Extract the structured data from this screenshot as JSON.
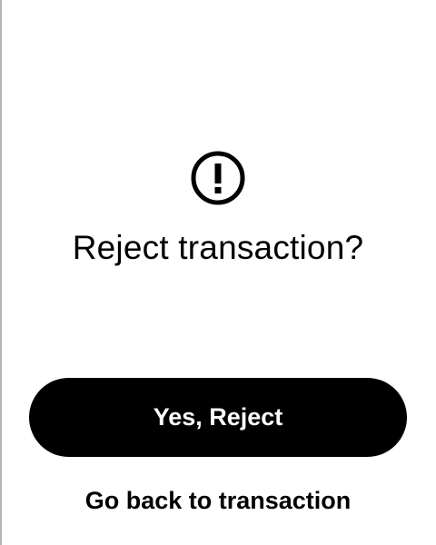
{
  "dialog": {
    "icon": "exclamation-circle-icon",
    "title": "Reject transaction?",
    "confirm_label": "Yes, Reject",
    "back_label": "Go back to transaction"
  },
  "colors": {
    "background": "#ffffff",
    "button_background": "#000000",
    "button_text": "#ffffff",
    "text": "#000000"
  }
}
